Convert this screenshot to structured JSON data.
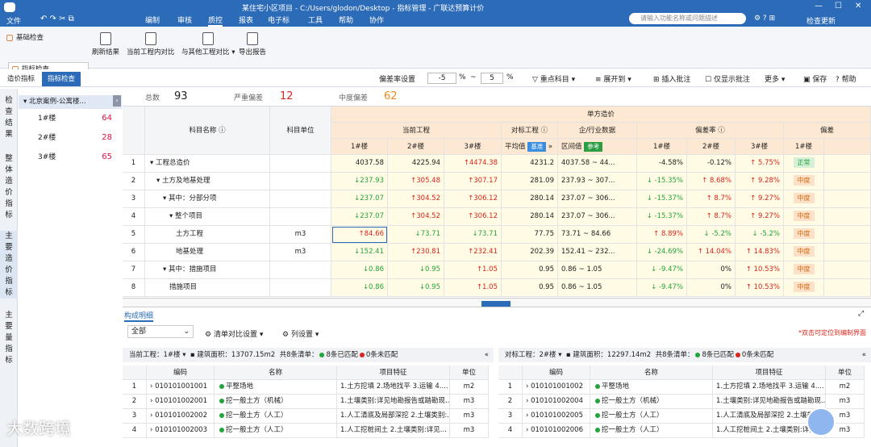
{
  "window": {
    "title": "某住宅小区项目 - C:/Users/glodon/Desktop - 指标管理 - 广联达预算计价",
    "file_menu": "文件"
  },
  "menu": [
    "编制",
    "审核",
    "质控",
    "报表",
    "电子标",
    "工具",
    "帮助",
    "协作"
  ],
  "search_placeholder": "请输入功能名称或问题描述",
  "check_update": "检查更新",
  "ribbon": {
    "left": [
      "基础检查",
      "指标检查"
    ],
    "buttons": [
      "刷新结果",
      "当前工程内对比",
      "与其他工程对比",
      "导出报告"
    ]
  },
  "tabs": [
    "造价指标",
    "指标检查"
  ],
  "toolbar2": {
    "deviation": "偏差率设置",
    "low": "-5",
    "high": "5",
    "pct": "%",
    "tilde": "~",
    "focus": "重点科目",
    "expand": "展开到",
    "insert_note": "插入批注",
    "only_note": "仅显示批注",
    "more": "更多",
    "save": "保存",
    "help": "帮助"
  },
  "vtabs": [
    "检查结果",
    "整体造价指标",
    "主要造价指标",
    "主要量指标"
  ],
  "tree": {
    "root": "北京案例-公寓楼...",
    "items": [
      {
        "label": "1#楼",
        "count": "64"
      },
      {
        "label": "2#楼",
        "count": "28"
      },
      {
        "label": "3#楼",
        "count": "65"
      }
    ]
  },
  "summary": {
    "total_label": "总数",
    "total": "93",
    "severe_label": "严重偏差",
    "severe": "12",
    "mid_label": "中度偏差",
    "mid": "62"
  },
  "grid": {
    "h_name": "科目名称",
    "h_unit": "科目单位",
    "h_unitcost": "单方造价",
    "h_current": "当前工程",
    "h_compare": "对标工程",
    "h_industry": "企/行业数据",
    "h_dev": "偏差率",
    "h_dev2": "偏差",
    "h_b1": "1#楼",
    "h_b2": "2#楼",
    "h_b3": "3#楼",
    "h_avg": "平均值",
    "h_base": "基准",
    "h_range": "区间值",
    "h_ref": "参考",
    "h_c1": "1#楼",
    "h_c2": "2#楼",
    "h_c3": "3#楼",
    "h_l1": "1#楼",
    "rows": [
      {
        "no": "1",
        "name": "工程总造价",
        "unit": "",
        "v1": "4037.58",
        "v2": "4225.94",
        "v3": "4474.38",
        "avg": "4231.2",
        "range": "4037.58 ~ 44...",
        "d1": "-4.58%",
        "d2": "-0.12%",
        "d3": "5.75%",
        "lvl": "正常"
      },
      {
        "no": "2",
        "name": "土方及地基处理",
        "unit": "",
        "v1": "237.93",
        "v2": "305.48",
        "v3": "307.17",
        "avg": "281.09",
        "range": "237.93 ~ 307...",
        "d1": "-15.35%",
        "d2": "8.68%",
        "d3": "9.28%",
        "lvl": "中度"
      },
      {
        "no": "3",
        "name": "其中：分部分项",
        "unit": "",
        "v1": "237.07",
        "v2": "304.52",
        "v3": "306.12",
        "avg": "280.14",
        "range": "237.07 ~ 306...",
        "d1": "-15.37%",
        "d2": "8.7%",
        "d3": "9.27%",
        "lvl": "中度"
      },
      {
        "no": "4",
        "name": "整个项目",
        "unit": "",
        "v1": "237.07",
        "v2": "304.52",
        "v3": "306.12",
        "avg": "280.14",
        "range": "237.07 ~ 306...",
        "d1": "-15.37%",
        "d2": "8.7%",
        "d3": "9.27%",
        "lvl": "中度"
      },
      {
        "no": "5",
        "name": "土方工程",
        "unit": "m3",
        "v1": "84.66",
        "v2": "73.71",
        "v3": "73.71",
        "avg": "77.75",
        "range": "73.71 ~ 84.66",
        "d1": "8.89%",
        "d2": "-5.2%",
        "d3": "-5.2%",
        "lvl": "中度"
      },
      {
        "no": "6",
        "name": "地基处理",
        "unit": "m3",
        "v1": "152.41",
        "v2": "230.81",
        "v3": "232.41",
        "avg": "202.39",
        "range": "152.41 ~ 232...",
        "d1": "-24.69%",
        "d2": "14.04%",
        "d3": "14.83%",
        "lvl": "中度"
      },
      {
        "no": "7",
        "name": "其中：措施项目",
        "unit": "",
        "v1": "0.86",
        "v2": "0.95",
        "v3": "1.05",
        "avg": "0.95",
        "range": "0.86 ~ 1.05",
        "d1": "-9.47%",
        "d2": "0%",
        "d3": "10.53%",
        "lvl": "中度"
      },
      {
        "no": "8",
        "name": "措施项目",
        "unit": "",
        "v1": "0.86",
        "v2": "0.95",
        "v3": "1.05",
        "avg": "0.95",
        "range": "0.86 ~ 1.05",
        "d1": "-9.47%",
        "d2": "0%",
        "d3": "10.53%",
        "lvl": "中度"
      }
    ]
  },
  "bottom": {
    "tab": "构成明细",
    "filter": "全部",
    "list_setting": "清单对比设置",
    "col_setting": "列设置",
    "hint": "*双击可定位到编制界面",
    "left": {
      "cur": "当前工程：",
      "bld": "1#楼",
      "area_label": "建筑面积：",
      "area": "13707.15m2",
      "total": "共8条清单：",
      "matched": "8条已匹配",
      "unmatched": "0条未匹配"
    },
    "right": {
      "cur": "对标工程：",
      "bld": "2#楼",
      "area_label": "建筑面积：",
      "area": "12297.14m2",
      "total": "共8条清单：",
      "matched": "8条已匹配",
      "unmatched": "0条未匹配"
    },
    "cols": [
      "编码",
      "名称",
      "项目特征",
      "单位"
    ],
    "left_rows": [
      {
        "no": "1",
        "code": "010101001001",
        "name": "平整场地",
        "feat": "1.土方挖填 2.场地找平 3.运输 4....",
        "unit": "m2"
      },
      {
        "no": "2",
        "code": "010101002001",
        "name": "挖一般土方（机械）",
        "feat": "1.土壤类别:详见地勘报告或踏勘现...",
        "unit": "m3"
      },
      {
        "no": "3",
        "code": "010101002002",
        "name": "挖一般土方（人工）",
        "feat": "1.人工清底及局部深挖 2.土壤类别:...",
        "unit": "m3"
      },
      {
        "no": "4",
        "code": "010101002003",
        "name": "挖一般土方（人工）",
        "feat": "1.人工挖桩间土 2.土壤类别:详见...",
        "unit": "m3"
      }
    ],
    "right_rows": [
      {
        "no": "1",
        "code": "010101001002",
        "name": "平整场地",
        "feat": "1.土方挖填 2.场地找平 3.运输 4....",
        "unit": "m2"
      },
      {
        "no": "2",
        "code": "010101002004",
        "name": "挖一般土方（机械）",
        "feat": "1.土壤类别:详见地勘报告或踏勘现...",
        "unit": "m3"
      },
      {
        "no": "3",
        "code": "010101002005",
        "name": "挖一般土方（人工）",
        "feat": "1.人工清底及局部深挖 2.土壤类别:...",
        "unit": "m3"
      },
      {
        "no": "4",
        "code": "010101002006",
        "name": "挖一般土方（人工）",
        "feat": "1.人工挖桩间土 2.土壤类别:详见...",
        "unit": "m3"
      }
    ]
  },
  "watermark": "大数跨境"
}
